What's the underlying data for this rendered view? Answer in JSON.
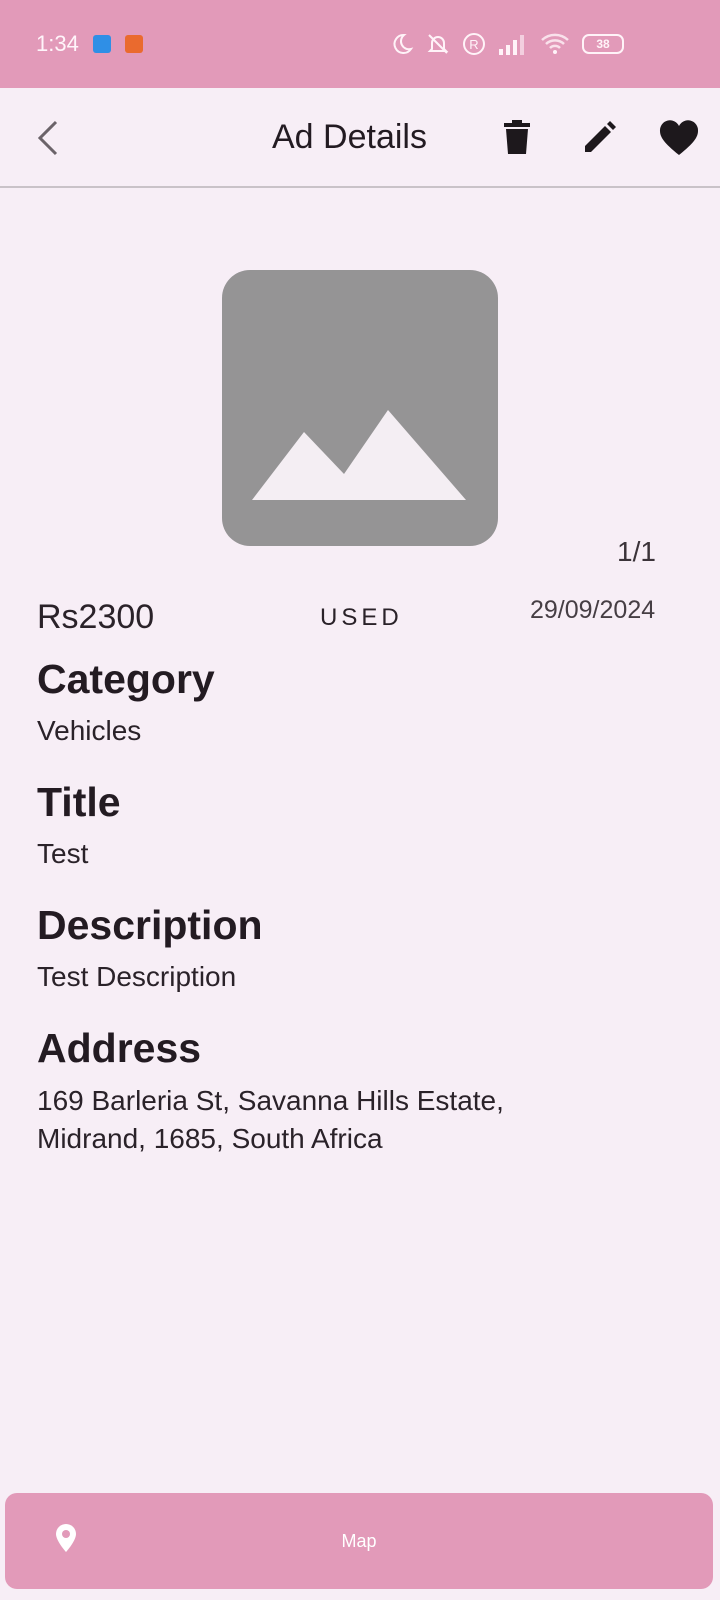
{
  "status_bar": {
    "time": "1:34",
    "battery": "38"
  },
  "app_bar": {
    "title": "Ad Details",
    "icons": [
      "back-chevron-icon",
      "delete-icon",
      "edit-icon",
      "favorite-heart-icon"
    ]
  },
  "gallery": {
    "counter": "1/1",
    "placeholder_icon": "image-placeholder-icon"
  },
  "ad": {
    "price": "Rs2300",
    "condition": "USED",
    "date": "29/09/2024",
    "fields": [
      {
        "label": "Category",
        "value": "Vehicles"
      },
      {
        "label": "Title",
        "value": "Test"
      },
      {
        "label": "Description",
        "value": "Test Description"
      },
      {
        "label": "Address",
        "value": "169 Barleria St, Savanna Hills Estate, Midrand, 1685, South Africa"
      }
    ]
  },
  "map_button": {
    "label": "Map",
    "icon": "location-pin-icon"
  },
  "colors": {
    "accent": "#e29ab9",
    "background": "#f7eef6",
    "placeholder": "#959495"
  }
}
